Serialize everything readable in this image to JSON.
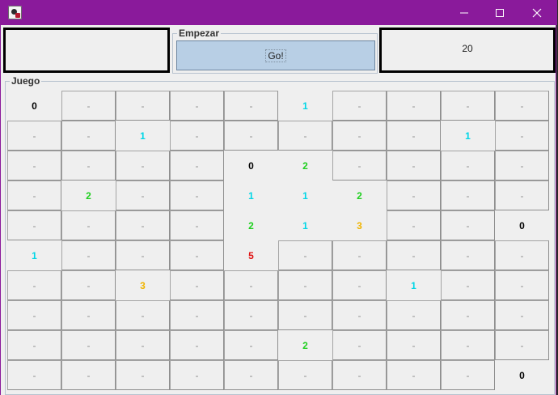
{
  "colors": {
    "titlebar": "#8a1a9b",
    "n0": "#000000",
    "n1": "#00d6e6",
    "n2": "#1ecf1e",
    "n3": "#f0b400",
    "n5": "#e01010",
    "closed": "#8c8c8c"
  },
  "window": {
    "minimize_icon": "minimize-icon",
    "maximize_icon": "maximize-icon",
    "close_icon": "close-icon"
  },
  "empezar": {
    "title": "Empezar",
    "button_label": "Go!"
  },
  "counter": "20",
  "juego": {
    "title": "Juego"
  },
  "board": [
    [
      "0",
      "-",
      "-",
      "-",
      "-",
      "1",
      "-",
      "-",
      "-",
      "-"
    ],
    [
      "-",
      "-",
      "1",
      "-",
      "-",
      "-",
      "-",
      "-",
      "1",
      "-"
    ],
    [
      "-",
      "-",
      "-",
      "-",
      "0",
      "2",
      "-",
      "-",
      "-",
      "-"
    ],
    [
      "-",
      "2",
      "-",
      "-",
      "1",
      "1",
      "2",
      "-",
      "-",
      "-"
    ],
    [
      "-",
      "-",
      "-",
      "-",
      "2",
      "1",
      "3",
      "-",
      "-",
      "0"
    ],
    [
      "1",
      "-",
      "-",
      "-",
      "5",
      "-",
      "-",
      "-",
      "-",
      "-"
    ],
    [
      "-",
      "-",
      "3",
      "-",
      "-",
      "-",
      "-",
      "1",
      "-",
      "-"
    ],
    [
      "-",
      "-",
      "-",
      "-",
      "-",
      "-",
      "-",
      "-",
      "-",
      "-"
    ],
    [
      "-",
      "-",
      "-",
      "-",
      "-",
      "2",
      "-",
      "-",
      "-",
      "-"
    ],
    [
      "-",
      "-",
      "-",
      "-",
      "-",
      "-",
      "-",
      "-",
      "-",
      "0"
    ]
  ]
}
